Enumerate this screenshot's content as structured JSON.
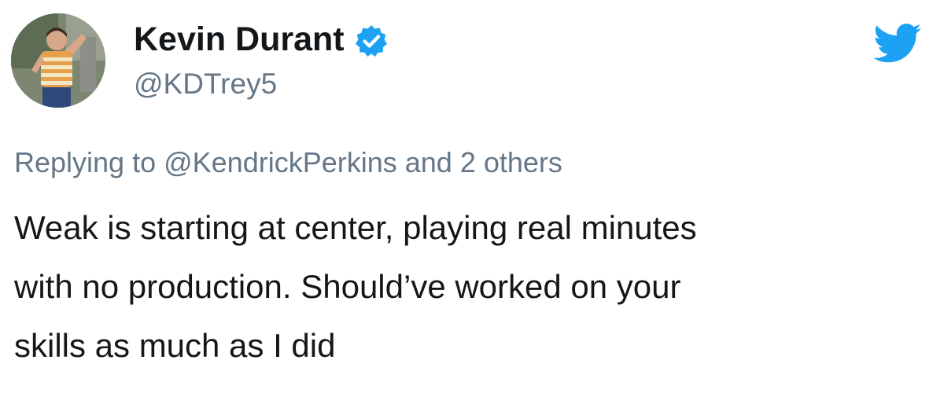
{
  "tweet": {
    "author": {
      "display_name": "Kevin Durant",
      "handle": "@KDTrey5",
      "verified": true,
      "avatar": "avatar-image"
    },
    "reply_context": "Replying to @KendrickPerkins and 2 others",
    "text_lines": [
      "Weak is starting at center, playing real minutes",
      "with no production. Should’ve worked on your",
      "skills as much as I did"
    ],
    "icons": {
      "verified": "verified-badge-icon",
      "brand": "twitter-bird-icon"
    }
  },
  "colors": {
    "brand_blue": "#1da1f2",
    "text_primary": "#14171a",
    "text_secondary": "#657786",
    "background": "#ffffff"
  }
}
